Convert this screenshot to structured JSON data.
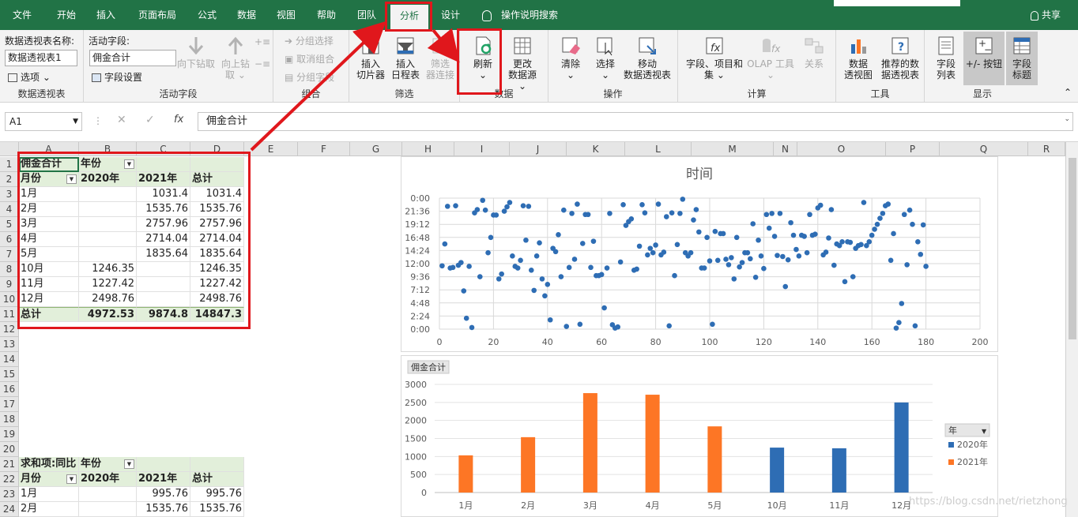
{
  "menu": {
    "tabs": [
      "文件",
      "开始",
      "插入",
      "页面布局",
      "公式",
      "数据",
      "视图",
      "帮助",
      "团队",
      "分析",
      "设计"
    ],
    "active_tab": "分析",
    "tell_me": "操作说明搜索",
    "share": "共享"
  },
  "ribbon": {
    "pivot_table": {
      "name_label": "数据透视表名称:",
      "name_value": "数据透视表1",
      "options": "选项",
      "group_label": "数据透视表"
    },
    "active_field": {
      "label": "活动字段:",
      "value": "佣金合计",
      "field_settings": "字段设置",
      "drill_down": "向下钻取",
      "drill_up_1": "向上钻",
      "drill_up_2": "取",
      "group_label": "活动字段"
    },
    "group": {
      "group_selection": "分组选择",
      "ungroup": "取消组合",
      "group_field": "分组字段",
      "group_label": "组合"
    },
    "filter": {
      "insert_slicer_1": "插入",
      "insert_slicer_2": "切片器",
      "insert_timeline_1": "插入",
      "insert_timeline_2": "日程表",
      "filter_conn_1": "筛选",
      "filter_conn_2": "器连接",
      "group_label": "筛选"
    },
    "data": {
      "refresh": "刷新",
      "change_source_1": "更改",
      "change_source_2": "数据源",
      "group_label": "数据"
    },
    "actions": {
      "clear": "清除",
      "select": "选择",
      "move_1": "移动",
      "move_2": "数据透视表",
      "group_label": "操作"
    },
    "calculations": {
      "fields_items_1": "字段、项目和",
      "fields_items_2": "集",
      "olap": "OLAP 工具",
      "relations": "关系",
      "group_label": "计算"
    },
    "tools": {
      "pivot_chart_1": "数据",
      "pivot_chart_2": "透视图",
      "recommended_1": "推荐的数",
      "recommended_2": "据透视表",
      "group_label": "工具"
    },
    "show": {
      "field_list_1": "字段",
      "field_list_2": "列表",
      "buttons": "+/- 按钮",
      "headers_1": "字段",
      "headers_2": "标题",
      "group_label": "显示"
    }
  },
  "formula_bar": {
    "cell_ref": "A1",
    "formula": "佣金合计"
  },
  "columns": [
    "A",
    "B",
    "C",
    "D",
    "E",
    "F",
    "G",
    "H",
    "I",
    "J",
    "K",
    "L",
    "M",
    "N",
    "O",
    "P",
    "Q",
    "R"
  ],
  "rows": [
    "1",
    "2",
    "3",
    "4",
    "5",
    "6",
    "7",
    "8",
    "9",
    "10",
    "11",
    "12",
    "13",
    "14",
    "15",
    "16",
    "17",
    "18",
    "19",
    "20",
    "21",
    "22",
    "23",
    "24"
  ],
  "pivot1": {
    "r1": [
      "佣金合计",
      "年份",
      "",
      ""
    ],
    "r2": [
      "月份",
      "2020年",
      "2021年",
      "总计"
    ],
    "body": [
      [
        "1月",
        "",
        "1031.4",
        "1031.4"
      ],
      [
        "2月",
        "",
        "1535.76",
        "1535.76"
      ],
      [
        "3月",
        "",
        "2757.96",
        "2757.96"
      ],
      [
        "4月",
        "",
        "2714.04",
        "2714.04"
      ],
      [
        "5月",
        "",
        "1835.64",
        "1835.64"
      ],
      [
        "10月",
        "1246.35",
        "",
        "1246.35"
      ],
      [
        "11月",
        "1227.42",
        "",
        "1227.42"
      ],
      [
        "12月",
        "2498.76",
        "",
        "2498.76"
      ]
    ],
    "total": [
      "总计",
      "4972.53",
      "9874.8",
      "14847.3"
    ]
  },
  "pivot2": {
    "r21": [
      "求和项:同比",
      "年份",
      "",
      ""
    ],
    "r22": [
      "月份",
      "2020年",
      "2021年",
      "总计"
    ],
    "body": [
      [
        "1月",
        "",
        "995.76",
        "995.76"
      ],
      [
        "2月",
        "",
        "1535.76",
        "1535.76"
      ]
    ]
  },
  "watermark": "https://blog.csdn.net/rietzhong",
  "scatter_chart": {
    "type": "scatter",
    "title": "时间",
    "xlim": [
      0,
      200
    ],
    "x_ticks": [
      "0",
      "20",
      "40",
      "60",
      "80",
      "100",
      "120",
      "140",
      "160",
      "180",
      "200"
    ],
    "y_ticks": [
      "0:00",
      "2:24",
      "4:48",
      "7:12",
      "9:36",
      "12:00",
      "14:24",
      "16:48",
      "19:12",
      "21:36",
      "0:00"
    ],
    "ylim_hours": [
      0,
      24
    ],
    "color": "#2e6db4",
    "points": [
      [
        1,
        11.6
      ],
      [
        2,
        15.6
      ],
      [
        3,
        22.5
      ],
      [
        4,
        11.2
      ],
      [
        5,
        11.3
      ],
      [
        6,
        22.6
      ],
      [
        7,
        11.7
      ],
      [
        8,
        12.2
      ],
      [
        9,
        7.0
      ],
      [
        10,
        2.0
      ],
      [
        11,
        11.5
      ],
      [
        12,
        0.3
      ],
      [
        13,
        21.3
      ],
      [
        14,
        21.9
      ],
      [
        15,
        9.6
      ],
      [
        16,
        23.6
      ],
      [
        17,
        21.8
      ],
      [
        18,
        14.0
      ],
      [
        19,
        16.8
      ],
      [
        20,
        20.9
      ],
      [
        21,
        20.9
      ],
      [
        22,
        9.2
      ],
      [
        23,
        10.1
      ],
      [
        24,
        21.6
      ],
      [
        25,
        22.4
      ],
      [
        26,
        23.2
      ],
      [
        27,
        13.4
      ],
      [
        28,
        11.5
      ],
      [
        29,
        11.2
      ],
      [
        30,
        12.6
      ],
      [
        31,
        22.6
      ],
      [
        32,
        16.3
      ],
      [
        33,
        22.5
      ],
      [
        34,
        10.8
      ],
      [
        35,
        7.1
      ],
      [
        36,
        13.4
      ],
      [
        37,
        15.8
      ],
      [
        38,
        9.2
      ],
      [
        39,
        6.1
      ],
      [
        40,
        8.2
      ],
      [
        41,
        1.7
      ],
      [
        42,
        14.8
      ],
      [
        43,
        14.2
      ],
      [
        44,
        17.3
      ],
      [
        45,
        9.6
      ],
      [
        46,
        21.8
      ],
      [
        47,
        0.5
      ],
      [
        48,
        11.3
      ],
      [
        49,
        21.2
      ],
      [
        50,
        12.8
      ],
      [
        51,
        22.9
      ],
      [
        52,
        0.9
      ],
      [
        53,
        15.7
      ],
      [
        54,
        21.0
      ],
      [
        55,
        21.0
      ],
      [
        56,
        11.3
      ],
      [
        57,
        16.1
      ],
      [
        58,
        9.8
      ],
      [
        59,
        9.8
      ],
      [
        60,
        10.0
      ],
      [
        61,
        3.9
      ],
      [
        62,
        11.2
      ],
      [
        63,
        21.2
      ],
      [
        64,
        0.8
      ],
      [
        65,
        0.2
      ],
      [
        66,
        0.4
      ],
      [
        67,
        12.3
      ],
      [
        68,
        22.8
      ],
      [
        69,
        19.0
      ],
      [
        70,
        19.7
      ],
      [
        71,
        20.2
      ],
      [
        72,
        10.8
      ],
      [
        73,
        11.0
      ],
      [
        74,
        15.2
      ],
      [
        75,
        22.8
      ],
      [
        76,
        21.3
      ],
      [
        77,
        13.6
      ],
      [
        78,
        14.8
      ],
      [
        79,
        14.0
      ],
      [
        80,
        15.4
      ],
      [
        81,
        22.9
      ],
      [
        82,
        13.6
      ],
      [
        83,
        14.1
      ],
      [
        84,
        20.6
      ],
      [
        85,
        0.6
      ],
      [
        86,
        21.3
      ],
      [
        87,
        9.8
      ],
      [
        88,
        15.5
      ],
      [
        89,
        21.2
      ],
      [
        90,
        23.8
      ],
      [
        91,
        14.0
      ],
      [
        92,
        13.4
      ],
      [
        93,
        14.0
      ],
      [
        94,
        20.0
      ],
      [
        95,
        21.9
      ],
      [
        96,
        17.8
      ],
      [
        97,
        11.2
      ],
      [
        98,
        11.2
      ],
      [
        99,
        16.8
      ],
      [
        100,
        12.5
      ],
      [
        101,
        0.9
      ],
      [
        102,
        17.9
      ],
      [
        103,
        12.6
      ],
      [
        104,
        17.5
      ],
      [
        105,
        17.5
      ],
      [
        106,
        12.8
      ],
      [
        107,
        11.8
      ],
      [
        108,
        13.1
      ],
      [
        109,
        9.2
      ],
      [
        110,
        16.8
      ],
      [
        111,
        11.4
      ],
      [
        112,
        12.2
      ],
      [
        113,
        14.0
      ],
      [
        114,
        14.0
      ],
      [
        115,
        12.9
      ],
      [
        116,
        19.3
      ],
      [
        117,
        9.5
      ],
      [
        118,
        16.3
      ],
      [
        119,
        13.4
      ],
      [
        120,
        11.1
      ],
      [
        121,
        21.0
      ],
      [
        122,
        18.5
      ],
      [
        123,
        21.2
      ],
      [
        124,
        17.0
      ],
      [
        125,
        13.5
      ],
      [
        126,
        21.2
      ],
      [
        127,
        13.3
      ],
      [
        128,
        7.8
      ],
      [
        129,
        12.7
      ],
      [
        130,
        19.5
      ],
      [
        131,
        17.2
      ],
      [
        132,
        14.6
      ],
      [
        133,
        13.4
      ],
      [
        134,
        17.2
      ],
      [
        135,
        17.0
      ],
      [
        136,
        14.0
      ],
      [
        137,
        21.0
      ],
      [
        138,
        17.2
      ],
      [
        139,
        17.4
      ],
      [
        140,
        22.2
      ],
      [
        141,
        22.7
      ],
      [
        142,
        13.6
      ],
      [
        143,
        14.1
      ],
      [
        144,
        16.7
      ],
      [
        145,
        21.9
      ],
      [
        146,
        11.7
      ],
      [
        147,
        15.6
      ],
      [
        148,
        15.3
      ],
      [
        149,
        16.0
      ],
      [
        150,
        8.7
      ],
      [
        151,
        16.0
      ],
      [
        152,
        15.9
      ],
      [
        153,
        9.6
      ],
      [
        154,
        14.8
      ],
      [
        155,
        15.3
      ],
      [
        156,
        15.5
      ],
      [
        157,
        23.2
      ],
      [
        158,
        15.3
      ],
      [
        159,
        16.0
      ],
      [
        160,
        17.2
      ],
      [
        161,
        18.3
      ],
      [
        162,
        19.2
      ],
      [
        163,
        20.3
      ],
      [
        164,
        21.2
      ],
      [
        165,
        22.6
      ],
      [
        166,
        22.9
      ],
      [
        167,
        12.6
      ],
      [
        168,
        17.5
      ],
      [
        169,
        0.2
      ],
      [
        170,
        1.2
      ],
      [
        171,
        4.7
      ],
      [
        172,
        21.0
      ],
      [
        173,
        11.8
      ],
      [
        174,
        21.8
      ],
      [
        175,
        19.2
      ],
      [
        176,
        0.6
      ],
      [
        177,
        16.0
      ],
      [
        178,
        13.7
      ],
      [
        179,
        19.1
      ],
      [
        180,
        11.5
      ]
    ]
  },
  "bar_chart": {
    "type": "bar",
    "field_button": "佣金合计",
    "categories": [
      "1月",
      "2月",
      "3月",
      "4月",
      "5月",
      "10月",
      "11月",
      "12月"
    ],
    "ylim": [
      0,
      3000
    ],
    "y_ticks": [
      "0",
      "500",
      "1000",
      "1500",
      "2000",
      "2500",
      "3000"
    ],
    "legend_title": "年",
    "series": [
      {
        "name": "2020年",
        "color": "#2e6db4",
        "values": [
          0,
          0,
          0,
          0,
          0,
          1246.35,
          1227.42,
          2498.76
        ]
      },
      {
        "name": "2021年",
        "color": "#fd7625",
        "values": [
          1031.4,
          1535.76,
          2757.96,
          2714.04,
          1835.64,
          0,
          0,
          0
        ]
      }
    ]
  },
  "colors": {
    "excel_green": "#217346",
    "annotation_red": "#e0171c",
    "pivot_header_fill": "#e2efda"
  }
}
